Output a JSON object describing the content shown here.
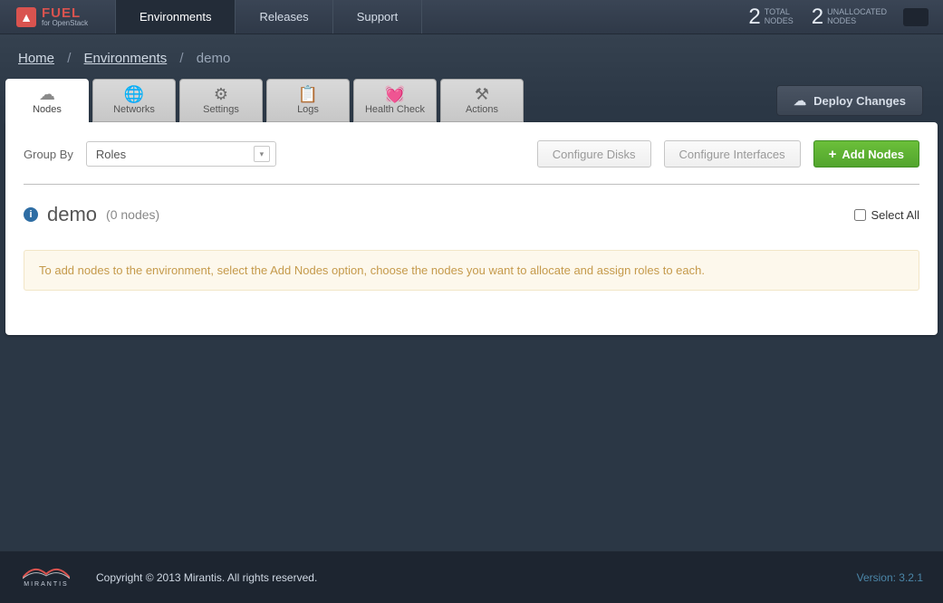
{
  "brand": {
    "name": "FUEL",
    "subtitle": "for OpenStack"
  },
  "nav": {
    "items": [
      {
        "label": "Environments"
      },
      {
        "label": "Releases"
      },
      {
        "label": "Support"
      }
    ]
  },
  "stats": {
    "total": {
      "value": "2",
      "label1": "TOTAL",
      "label2": "NODES"
    },
    "unallocated": {
      "value": "2",
      "label1": "UNALLOCATED",
      "label2": "NODES"
    }
  },
  "breadcrumb": {
    "home": "Home",
    "environments": "Environments",
    "current": "demo"
  },
  "tabs": [
    {
      "label": "Nodes"
    },
    {
      "label": "Networks"
    },
    {
      "label": "Settings"
    },
    {
      "label": "Logs"
    },
    {
      "label": "Health Check"
    },
    {
      "label": "Actions"
    }
  ],
  "deploy_label": "Deploy Changes",
  "group_by_label": "Group By",
  "group_by_value": "Roles",
  "buttons": {
    "configure_disks": "Configure Disks",
    "configure_interfaces": "Configure Interfaces",
    "add_nodes": "Add Nodes"
  },
  "env": {
    "name": "demo",
    "count": "(0 nodes)",
    "select_all": "Select All"
  },
  "hint": "To add nodes to the environment, select the Add Nodes option, choose the nodes you want to allocate and assign roles to each.",
  "footer": {
    "brand": "MIRANTIS",
    "copyright": "Copyright © 2013 Mirantis. All rights reserved.",
    "version": "Version: 3.2.1"
  }
}
